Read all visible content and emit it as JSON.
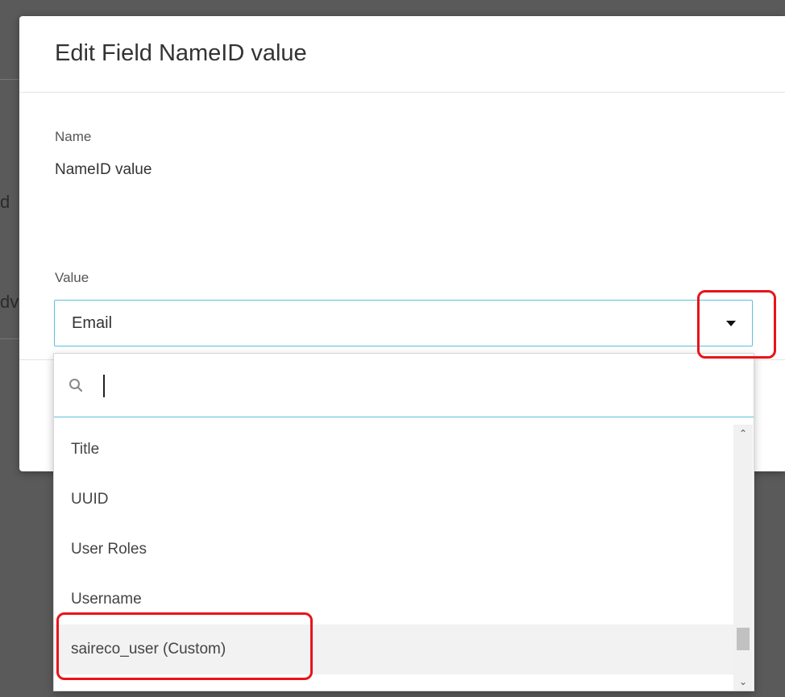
{
  "backdrop": {
    "fragment_1": "d",
    "fragment_2": "dv"
  },
  "modal": {
    "title": "Edit Field NameID value",
    "name_label": "Name",
    "name_value": "NameID value",
    "value_label": "Value",
    "select": {
      "selected_value": "Email"
    }
  },
  "dropdown": {
    "search": {
      "value": "",
      "placeholder": ""
    },
    "items": [
      "Title",
      "UUID",
      "User Roles",
      "Username",
      "saireco_user (Custom)"
    ],
    "highlighted_item": "saireco_user (Custom)"
  },
  "icons": {
    "search": "search-icon",
    "dropdown_arrow": "caret-down-icon",
    "scroll_up": "chevron-up-icon",
    "scroll_down": "chevron-down-icon"
  },
  "colors": {
    "accent": "#5bc0de",
    "annotation": "#e8141b",
    "highlight": "#f2f2f2"
  }
}
